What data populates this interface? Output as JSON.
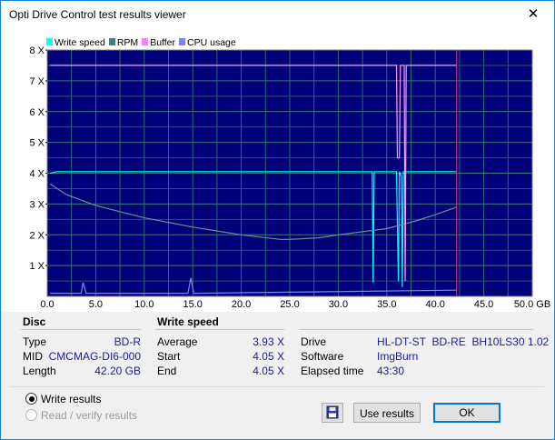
{
  "window": {
    "title": "Opti Drive Control test results viewer",
    "close": "✕"
  },
  "legend": [
    {
      "label": "Write speed",
      "color": "#00ffff"
    },
    {
      "label": "RPM",
      "color": "#3f7f7f"
    },
    {
      "label": "Buffer",
      "color": "#ff7fff"
    },
    {
      "label": "CPU usage",
      "color": "#8080ff"
    }
  ],
  "chart_data": {
    "type": "line",
    "xlabel": "",
    "ylabel": "",
    "xlim": [
      0,
      50
    ],
    "ylim": [
      0,
      8
    ],
    "x_ticks": [
      "0.0",
      "5.0",
      "10.0",
      "15.0",
      "20.0",
      "25.0",
      "30.0",
      "35.0",
      "40.0",
      "45.0",
      "50.0 GB"
    ],
    "y_ticks": [
      "1 X",
      "2 X",
      "3 X",
      "4 X",
      "5 X",
      "6 X",
      "7 X",
      "8 X"
    ],
    "grid": true,
    "legend_position": "top-left",
    "end_marker_x": 42.2,
    "series": [
      {
        "name": "Write speed",
        "color": "#00ffff",
        "x": [
          0.3,
          1,
          2,
          3,
          5,
          10,
          15,
          20,
          25,
          30,
          33.5,
          33.6,
          33.7,
          34,
          36,
          36.2,
          36.3,
          36.5,
          36.6,
          36.7,
          37,
          38,
          40,
          42.2
        ],
        "y": [
          4.0,
          4.05,
          4.05,
          4.05,
          4.05,
          4.05,
          4.05,
          4.05,
          4.05,
          4.05,
          4.05,
          0.45,
          4.05,
          4.05,
          4.05,
          0.5,
          4.05,
          3.9,
          0.3,
          4.05,
          4.05,
          4.05,
          4.05,
          4.05
        ]
      },
      {
        "name": "RPM",
        "color": "#6f8f8f",
        "x": [
          0.3,
          2,
          5,
          10,
          15,
          20,
          24,
          25,
          28,
          30,
          35,
          38,
          40,
          42.2
        ],
        "y": [
          3.65,
          3.3,
          2.95,
          2.55,
          2.25,
          2.0,
          1.85,
          1.85,
          1.9,
          2.0,
          2.2,
          2.45,
          2.65,
          2.9
        ]
      },
      {
        "name": "Buffer",
        "color": "#ff99ff",
        "x": [
          0.3,
          36.0,
          36.1,
          36.3,
          36.4,
          36.8,
          36.9,
          37.0,
          42.2
        ],
        "y": [
          7.5,
          7.5,
          4.5,
          4.5,
          7.5,
          7.5,
          0.5,
          7.5,
          7.5
        ]
      },
      {
        "name": "CPU usage",
        "color": "#8080ff",
        "x": [
          0.3,
          3.5,
          3.7,
          4.0,
          4.3,
          14.5,
          14.8,
          15.1,
          15.4,
          42.2
        ],
        "y": [
          0.1,
          0.1,
          0.45,
          0.1,
          0.1,
          0.1,
          0.6,
          0.1,
          0.1,
          0.2
        ]
      }
    ]
  },
  "disc": {
    "header": "Disc",
    "rows": [
      {
        "label": "Type",
        "value": "BD-R"
      },
      {
        "label": "MID",
        "value": "CMCMAG-DI6-000"
      },
      {
        "label": "Length",
        "value": "42.20 GB"
      }
    ]
  },
  "write_speed": {
    "header": "Write speed",
    "rows": [
      {
        "label": "Average",
        "value": "3.93 X"
      },
      {
        "label": "Start",
        "value": "4.05 X"
      },
      {
        "label": "End",
        "value": "4.05 X"
      }
    ]
  },
  "drive_info": {
    "rows": [
      {
        "label": "Drive",
        "value": "HL-DT-ST  BD-RE  BH10LS30 1.02"
      },
      {
        "label": "Software",
        "value": "ImgBurn"
      },
      {
        "label": "Elapsed time",
        "value": "43:30"
      }
    ]
  },
  "mode": {
    "write_results": {
      "label": "Write results",
      "selected": true
    },
    "read_verify": {
      "label": "Read / verify results",
      "selected": false,
      "disabled": true
    }
  },
  "buttons": {
    "save_icon": "floppy-disk-icon",
    "use_results": "Use results",
    "ok": "OK"
  }
}
